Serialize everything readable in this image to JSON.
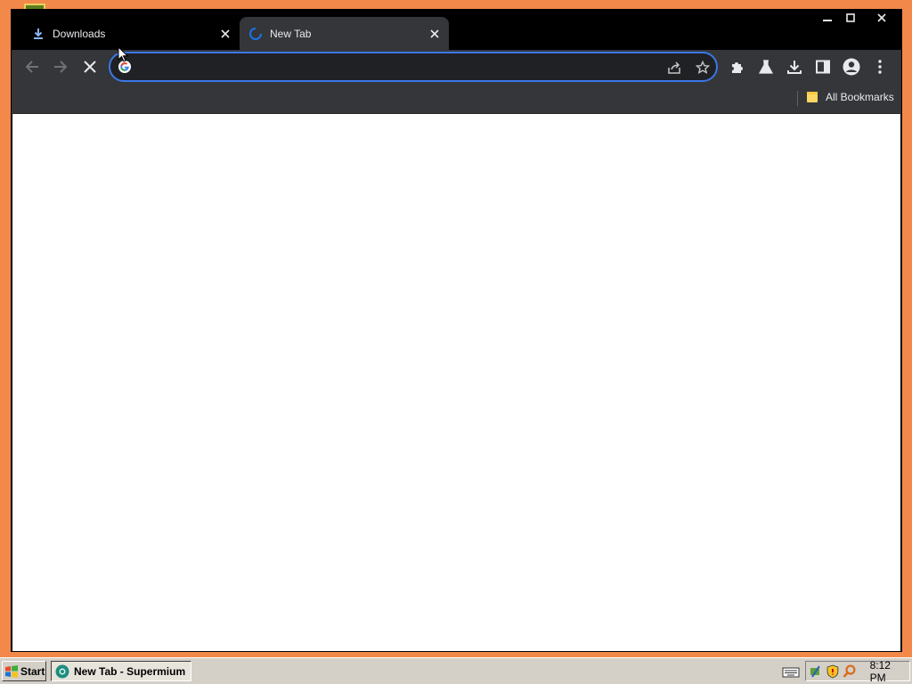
{
  "browser": {
    "tabs": [
      {
        "title": "Downloads",
        "icon": "download-icon",
        "active": false
      },
      {
        "title": "New Tab",
        "icon": "loading-spinner-icon",
        "active": true
      }
    ],
    "omnibox": {
      "value": "",
      "placeholder": ""
    },
    "bookmarks": {
      "all_label": "All Bookmarks"
    },
    "accent_color": "#3b78e7",
    "theme": "dark"
  },
  "taskbar": {
    "start_label": "Start",
    "task_label": "New Tab - Supermium",
    "clock": "8:12 PM"
  }
}
